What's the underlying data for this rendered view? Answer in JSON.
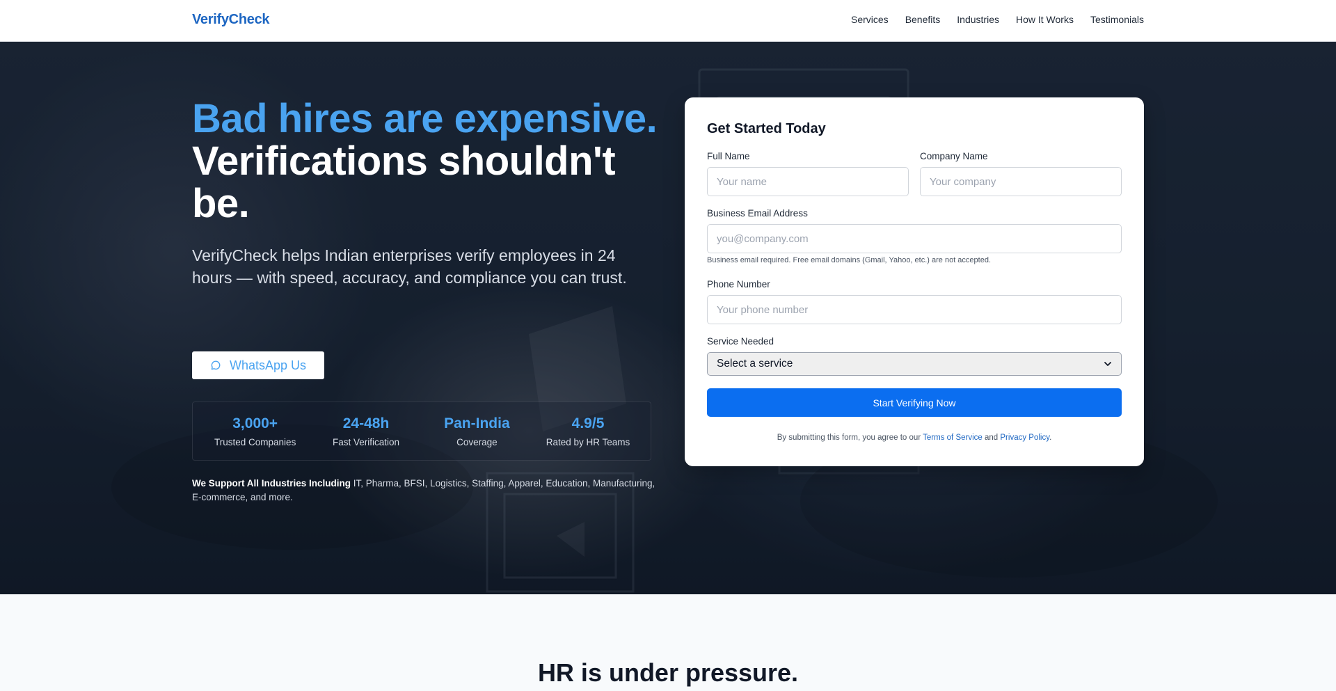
{
  "header": {
    "logo": "VerifyCheck",
    "nav": [
      "Services",
      "Benefits",
      "Industries",
      "How It Works",
      "Testimonials"
    ]
  },
  "hero": {
    "headline_blue": "Bad hires are expensive.",
    "headline_white": "Verifications shouldn't be.",
    "subheadline": "VerifyCheck helps Indian enterprises verify employees in 24 hours — with speed, accuracy, and compliance you can trust.",
    "whatsapp_label": "WhatsApp Us",
    "stats": [
      {
        "value": "3,000+",
        "label": "Trusted Companies"
      },
      {
        "value": "24-48h",
        "label": "Fast Verification"
      },
      {
        "value": "Pan-India",
        "label": "Coverage"
      },
      {
        "value": "4.9/5",
        "label": "Rated by HR Teams"
      }
    ],
    "industries_lead": "We Support All Industries Including",
    "industries_list": "IT, Pharma, BFSI, Logistics, Staffing, Apparel, Education, Manufacturing, E-commerce, and more."
  },
  "form": {
    "title": "Get Started Today",
    "full_name_label": "Full Name",
    "full_name_placeholder": "Your name",
    "company_label": "Company Name",
    "company_placeholder": "Your company",
    "email_label": "Business Email Address",
    "email_placeholder": "you@company.com",
    "email_hint": "Business email required. Free email domains (Gmail, Yahoo, etc.) are not accepted.",
    "phone_label": "Phone Number",
    "phone_placeholder": "Your phone number",
    "service_label": "Service Needed",
    "service_selected": "Select a service",
    "submit_label": "Start Verifying Now",
    "terms_prefix": "By submitting this form, you agree to our",
    "terms_link": "Terms of Service",
    "terms_and": "and",
    "privacy_link": "Privacy Policy",
    "terms_suffix": "."
  },
  "section2": {
    "title": "HR is under pressure."
  },
  "colors": {
    "accent": "#4aa3f0",
    "brand": "#1d66c2",
    "primary_button": "#0b6ef0"
  }
}
